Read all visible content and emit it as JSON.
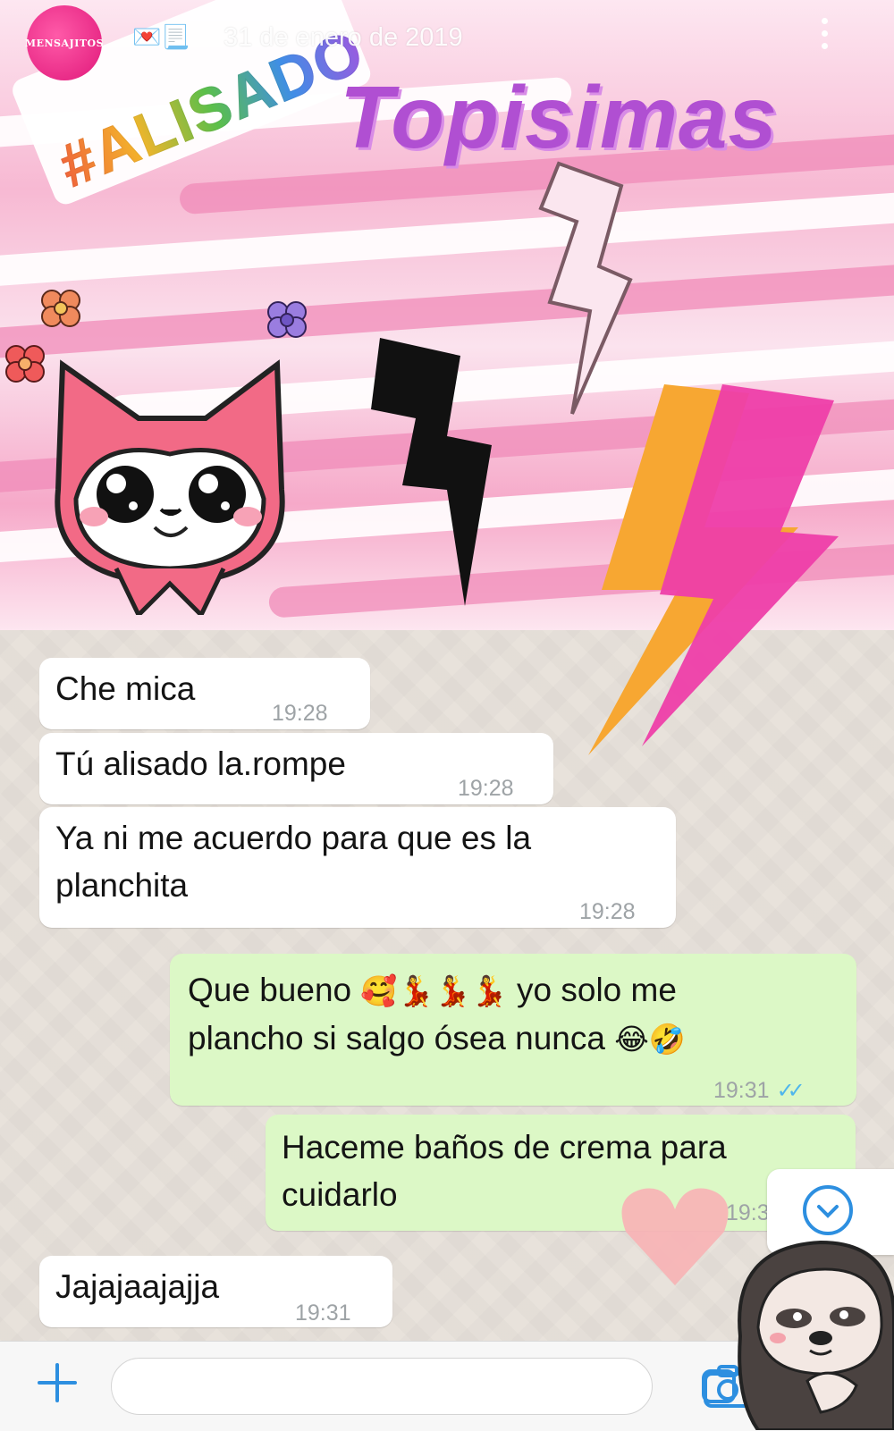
{
  "story": {
    "brand": "MENSAJITOS",
    "date": "31 de enero de 2019",
    "top_icons": "💌📃"
  },
  "stickers": {
    "hashtag": "#ALISADO",
    "headline": "Topisimas"
  },
  "messages": [
    {
      "dir": "in",
      "text": "Che mica",
      "time": "19:28"
    },
    {
      "dir": "in",
      "text": "Tú alisado la.rompe",
      "time": "19:28"
    },
    {
      "dir": "in",
      "line1": "Ya ni me acuerdo para que es la",
      "line2": "planchita",
      "time": "19:28"
    },
    {
      "dir": "out",
      "line1_a": "Que bueno",
      "line1_emoji": "🥰💃💃💃",
      "line1_b": "yo solo me",
      "line2_a": "plancho si salgo ósea nunca",
      "line2_emoji": "😂🤣",
      "time": "19:31",
      "status": "read"
    },
    {
      "dir": "out",
      "line1": "Haceme baños de crema para",
      "line2": "cuidarlo",
      "time": "19:3"
    },
    {
      "dir": "in",
      "text": "Jajajaajajja",
      "time": "19:31"
    }
  ],
  "colors": {
    "incoming": "#ffffff",
    "outgoing": "#dcf8c6",
    "accent": "#2d8fe0",
    "headline": "#b04fd2"
  },
  "icons": {
    "attach": "plus-icon",
    "sticker": "sticker-icon",
    "camera": "camera-icon",
    "scroll": "chevron-down-icon",
    "menu": "more-vertical-icon"
  }
}
